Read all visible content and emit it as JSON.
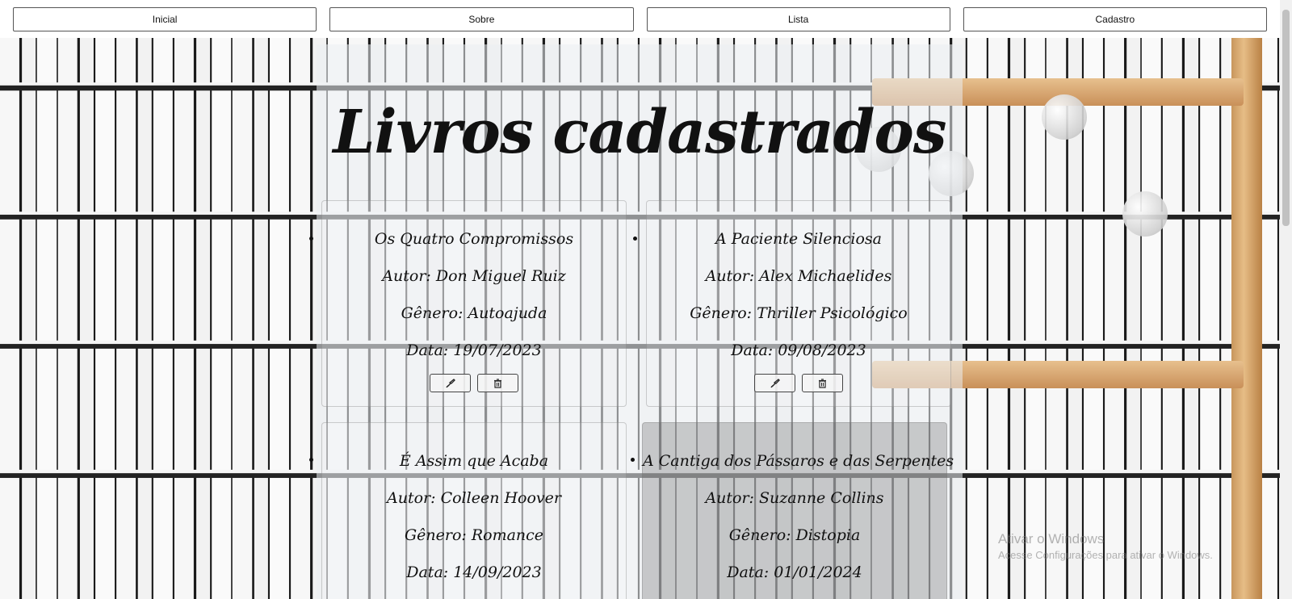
{
  "nav": {
    "items": [
      {
        "label": "Inicial"
      },
      {
        "label": "Sobre"
      },
      {
        "label": "Lista"
      },
      {
        "label": "Cadastro"
      }
    ]
  },
  "main": {
    "title": "Livros cadastrados",
    "books": [
      {
        "title": "Os Quatro Compromissos",
        "author": "Autor: Don Miguel Ruiz",
        "genre": "Gênero: Autoajuda",
        "date": "Data: 19/07/2023",
        "edit_icon": "brush-icon",
        "delete_icon": "trash-icon"
      },
      {
        "title": "A Paciente Silenciosa",
        "author": "Autor: Alex Michaelides",
        "genre": "Gênero: Thriller Psicológico",
        "date": "Data: 09/08/2023",
        "edit_icon": "brush-icon",
        "delete_icon": "trash-icon"
      },
      {
        "title": "É Assim que Acaba",
        "author": "Autor: Colleen Hoover",
        "genre": "Gênero: Romance",
        "date": "Data: 14/09/2023"
      },
      {
        "title": "A Cantiga dos Pássaros e das Serpentes",
        "author": "Autor: Suzanne Collins",
        "genre": "Gênero: Distopia",
        "date": "Data: 01/01/2024"
      }
    ]
  },
  "watermark": {
    "line1": "Ativar o Windows",
    "line2": "Acesse Configurações para ativar o Windows."
  }
}
